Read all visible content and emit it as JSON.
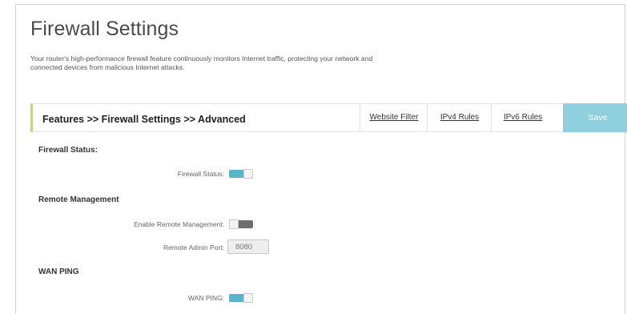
{
  "page": {
    "title": "Firewall Settings",
    "description": "Your router's high-performance firewall feature continuously monitors Internet traffic, protecting your network and connected devices from malicious Internet attacks."
  },
  "nav": {
    "breadcrumb": "Features >> Firewall Settings >> Advanced",
    "tabs": [
      "Website Filter",
      "IPv4 Rules",
      "IPv6 Rules"
    ],
    "save_label": "Save",
    "accent_color": "#b9d78e",
    "save_color": "#8fd0de"
  },
  "sections": {
    "firewall": {
      "heading": "Firewall Status:",
      "status_label": "Firewall Status:",
      "status_on": true
    },
    "remote": {
      "heading": "Remote Management",
      "enable_label": "Enable Remote Management:",
      "enable_on": false,
      "port_label": "Remote Admin Port:",
      "port_value": "8080"
    },
    "wan": {
      "heading": "WAN PING",
      "ping_label": "WAN PING:",
      "ping_on": true
    }
  },
  "colors": {
    "toggle_on": "#58b5cc",
    "toggle_off": "#6e6e6e"
  }
}
